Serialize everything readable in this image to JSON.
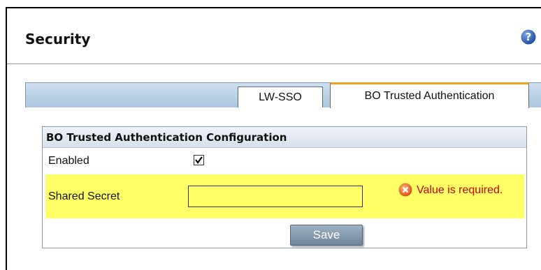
{
  "page": {
    "title": "Security"
  },
  "icons": {
    "help": "help-icon",
    "error": "error-icon",
    "checkmark": "checkmark-icon"
  },
  "tabs": [
    {
      "label": "LW-SSO",
      "active": false
    },
    {
      "label": "BO Trusted Authentication",
      "active": true
    }
  ],
  "panel": {
    "title": "BO Trusted Authentication Configuration",
    "enabled": {
      "label": "Enabled",
      "checked": true
    },
    "shared_secret": {
      "label": "Shared Secret",
      "value": "",
      "error": "Value is required."
    },
    "save_label": "Save"
  },
  "colors": {
    "error_highlight": "#ffff66",
    "error_text": "#cc0000",
    "active_tab_accent": "#f0a020",
    "help_icon": "#2a5db0"
  }
}
